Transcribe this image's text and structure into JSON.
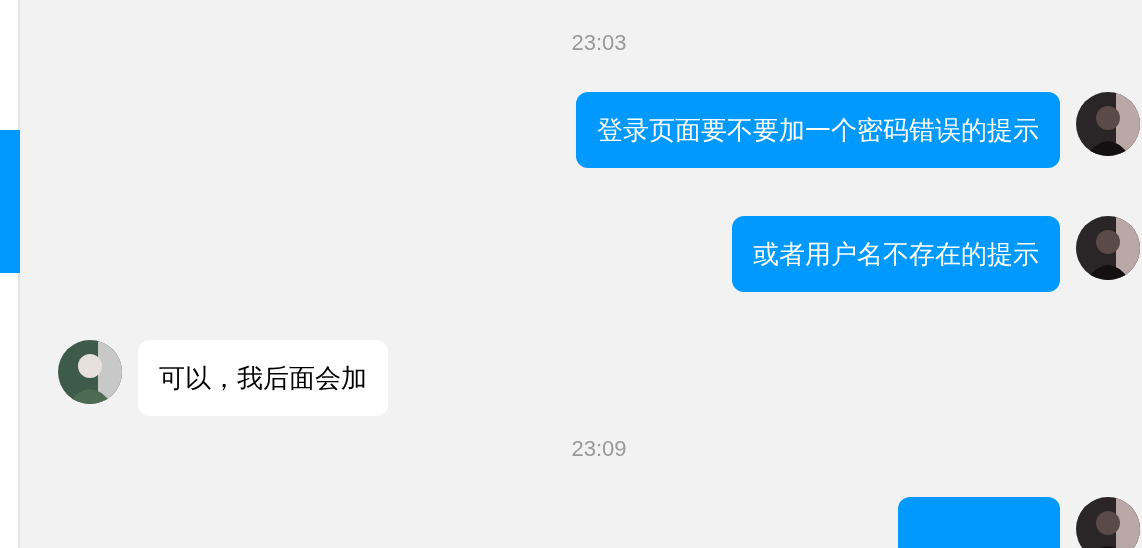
{
  "messages": [
    {
      "kind": "time",
      "text": "23:03"
    },
    {
      "kind": "outgoing",
      "text": "登录页面要不要加一个密码错误的提示"
    },
    {
      "kind": "outgoing",
      "text": "或者用户名不存在的提示"
    },
    {
      "kind": "incoming",
      "text": "可以，我后面会加"
    },
    {
      "kind": "time",
      "text": "23:09"
    },
    {
      "kind": "outgoing"
    }
  ]
}
